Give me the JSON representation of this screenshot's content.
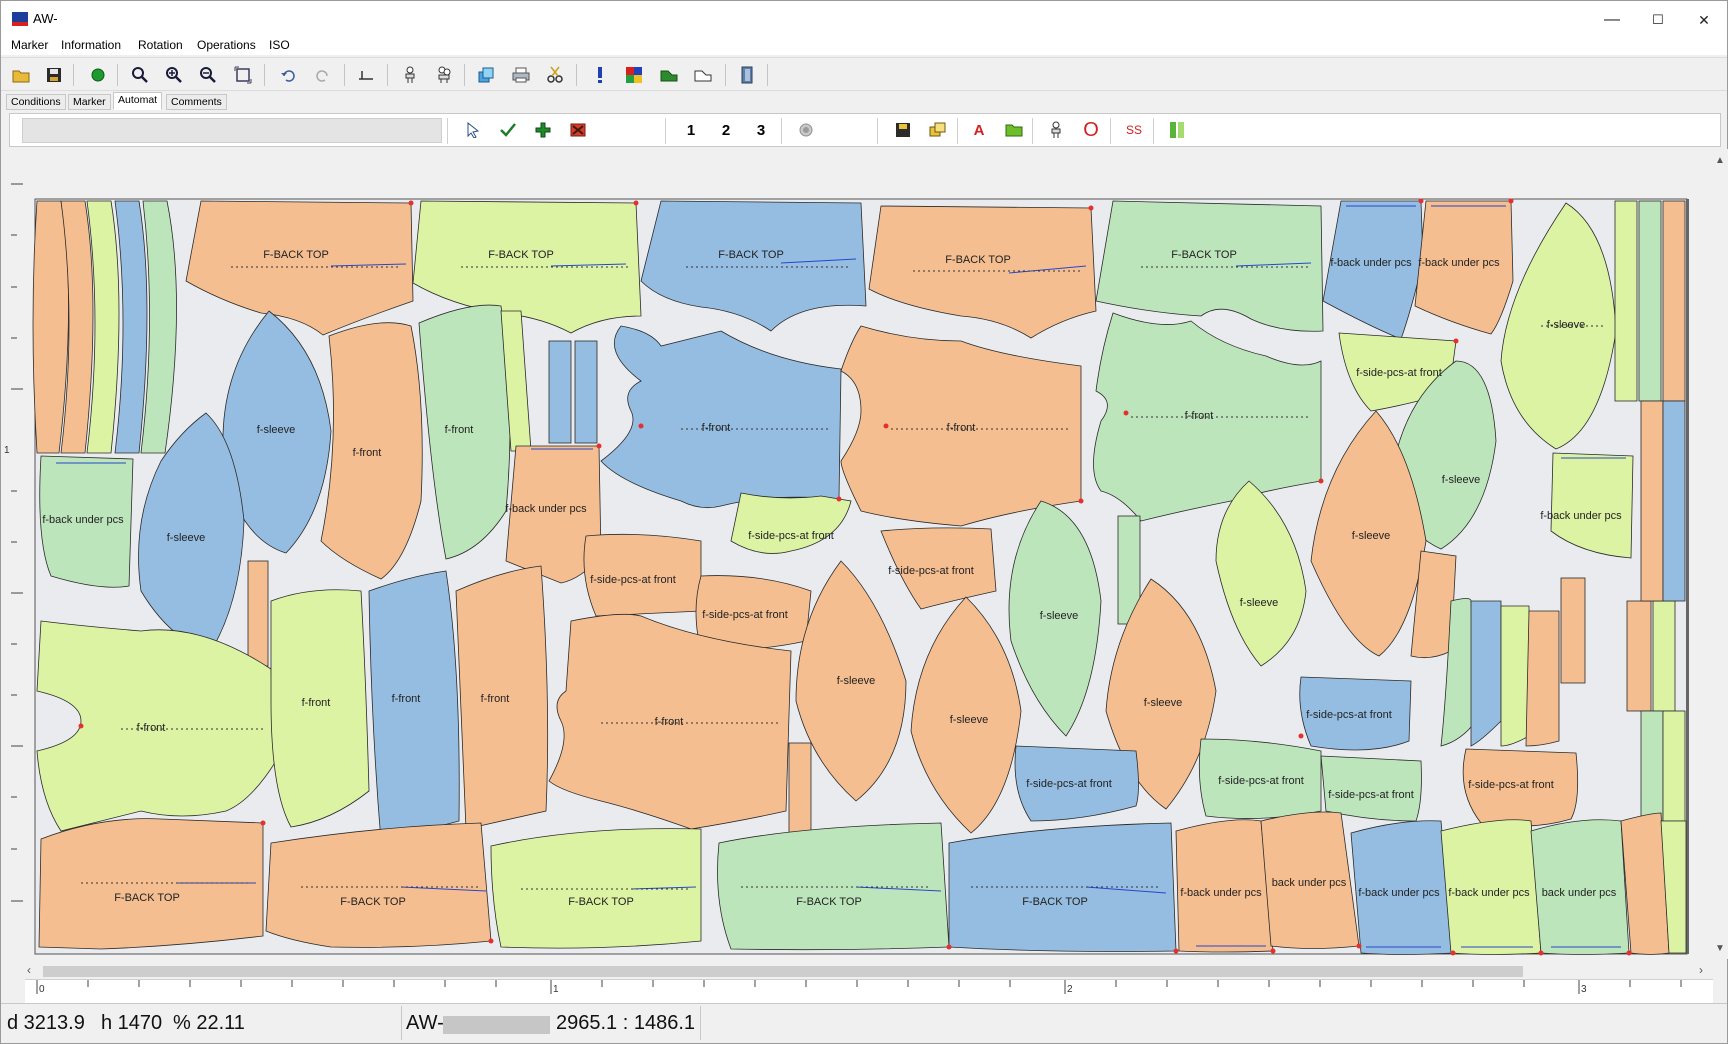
{
  "window": {
    "title": "AW-",
    "minimize": "—",
    "maximize": "☐",
    "close": "✕"
  },
  "menu": [
    "Marker",
    "Information",
    "Rotation",
    "Operations",
    "ISO"
  ],
  "tabs": [
    "Conditions",
    "Marker",
    "Automat",
    "Comments"
  ],
  "active_tab": "Automat",
  "toolbar2": {
    "nums": [
      "1",
      "2",
      "3"
    ],
    "a_label": "A",
    "o_label": "O",
    "ss_label": "SS"
  },
  "colors": {
    "orange": "#f5be91",
    "green": "#bde5bb",
    "blue": "#94bde1",
    "lime": "#dcf3a4",
    "canvas": "#e9ebee"
  },
  "pieces": {
    "back_top": "F-BACK TOP",
    "front": "f-front",
    "sleeve": "f-sleeve",
    "back_under": "f-back under pcs",
    "back_under_short": "back under pcs",
    "side_front": "f-side-pcs-at front"
  },
  "ruler": {
    "v_mark": "1",
    "h_marks": [
      "0",
      "1",
      "2",
      "3"
    ]
  },
  "status": {
    "d": "d 3213.9",
    "h": "h 1470",
    "pct": "% 22.11",
    "name": "AW-",
    "coords": "2965.1 : 1486.1"
  }
}
